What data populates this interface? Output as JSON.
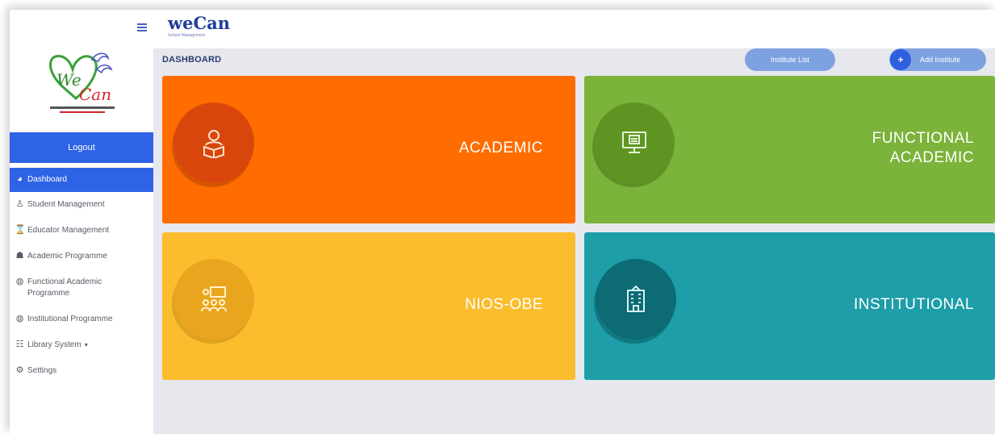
{
  "sidebar": {
    "logout_label": "Logout",
    "items": [
      {
        "label": "Dashboard",
        "icon": "dashboard-icon",
        "glyph": "◕"
      },
      {
        "label": "Student Management",
        "icon": "student-icon",
        "glyph": "♙"
      },
      {
        "label": "Educator Management",
        "icon": "educator-icon",
        "glyph": "⌛"
      },
      {
        "label": "Academic Programme",
        "icon": "graduation-cap-icon",
        "glyph": "☗"
      },
      {
        "label": "Functional Academic Programme",
        "icon": "globe-icon",
        "glyph": "◍"
      },
      {
        "label": "Institutional Programme",
        "icon": "globe-icon",
        "glyph": "◍"
      },
      {
        "label": "Library System",
        "icon": "library-icon",
        "glyph": "☷",
        "caret": "▾"
      },
      {
        "label": "Settings",
        "icon": "gear-icon",
        "glyph": "⚙"
      }
    ]
  },
  "header": {
    "brand_name": "weCan",
    "brand_sub": "School Management"
  },
  "dashboard": {
    "title": "DASHBOARD",
    "institute_list_label": "Institute List",
    "add_institute_label": "Add Institute",
    "add_icon": "+"
  },
  "cards": [
    {
      "label": "ACADEMIC",
      "icon": "student-reading-icon"
    },
    {
      "label": "FUNCTIONAL\nACADEMIC",
      "icon": "computer-icon"
    },
    {
      "label": "NIOS-OBE",
      "icon": "classroom-icon"
    },
    {
      "label": "INSTITUTIONAL",
      "icon": "building-icon"
    }
  ],
  "colors": {
    "primary": "#2f63e6",
    "academic": "#ff6d00",
    "functional": "#7cb33a",
    "nios": "#fbbd2e",
    "institutional": "#1d9ea8"
  }
}
